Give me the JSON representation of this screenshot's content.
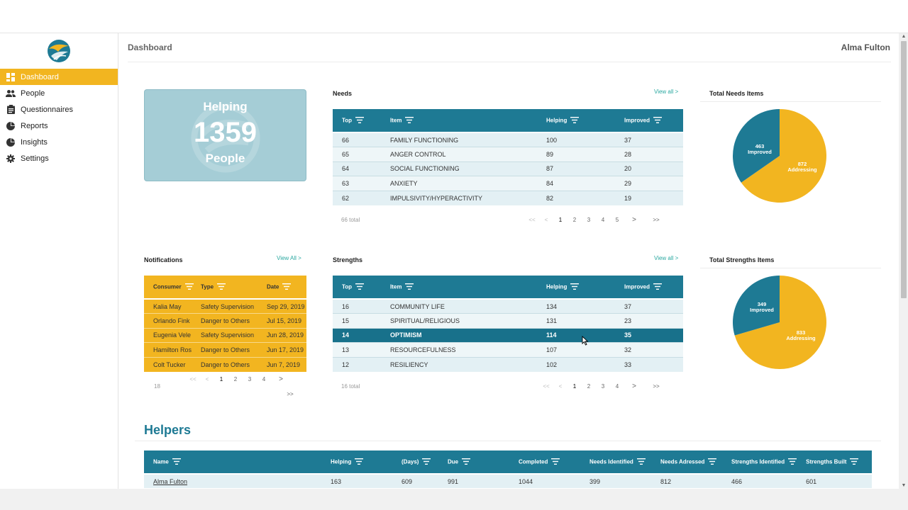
{
  "header": {
    "title": "Dashboard",
    "user": "Alma Fulton"
  },
  "sidebar": {
    "items": [
      {
        "label": "Dashboard",
        "icon": "dashboard-icon",
        "active": true
      },
      {
        "label": "People",
        "icon": "people-icon"
      },
      {
        "label": "Questionnaires",
        "icon": "clipboard-icon"
      },
      {
        "label": "Reports",
        "icon": "pie-chart-icon"
      },
      {
        "label": "Insights",
        "icon": "pie-chart-icon"
      },
      {
        "label": "Settings",
        "icon": "gear-icon"
      }
    ]
  },
  "helping_card": {
    "top": "Helping",
    "number": "1359",
    "bottom": "People"
  },
  "needs": {
    "title": "Needs",
    "view_all": "View all >",
    "columns": [
      "Top",
      "Item",
      "Helping",
      "Improved"
    ],
    "rows": [
      [
        "66",
        "FAMILY FUNCTIONING",
        "100",
        "37"
      ],
      [
        "65",
        "ANGER CONTROL",
        "89",
        "28"
      ],
      [
        "64",
        "SOCIAL FUNCTIONING",
        "87",
        "20"
      ],
      [
        "63",
        "ANXIETY",
        "84",
        "29"
      ],
      [
        "62",
        "IMPULSIVITY/HYPERACTIVITY",
        "82",
        "19"
      ]
    ],
    "total": "66 total",
    "pages": [
      "1",
      "2",
      "3",
      "4",
      "5"
    ]
  },
  "needs_pie": {
    "title": "Total Needs Items",
    "improved_value": "463",
    "improved_label": "Improved",
    "addressing_value": "872",
    "addressing_label": "Addressing"
  },
  "notifications": {
    "title": "Notifications",
    "view_all": "View All >",
    "columns": [
      "Consumer",
      "Type",
      "Date"
    ],
    "rows": [
      [
        "Kalia May",
        "Safety Supervision",
        "Sep 29, 2019"
      ],
      [
        "Orlando Fink",
        "Danger to Others",
        "Jul 15, 2019"
      ],
      [
        "Eugenia Vele",
        "Safety Supervision",
        "Jun 28, 2019"
      ],
      [
        "Hamilton Ros",
        "Danger to Others",
        "Jun 17, 2019"
      ],
      [
        "Colt Tucker",
        "Danger to Others",
        "Jun 7, 2019"
      ]
    ],
    "total": "18",
    "pages": [
      "1",
      "2",
      "3",
      "4"
    ]
  },
  "strengths": {
    "title": "Strengths",
    "view_all": "View all >",
    "columns": [
      "Top",
      "Item",
      "Helping",
      "Improved"
    ],
    "rows": [
      [
        "16",
        "COMMUNITY LIFE",
        "134",
        "37"
      ],
      [
        "15",
        "SPIRITUAL/RELIGIOUS",
        "131",
        "23"
      ],
      [
        "14",
        "OPTIMISM",
        "114",
        "35"
      ],
      [
        "13",
        "RESOURCEFULNESS",
        "107",
        "32"
      ],
      [
        "12",
        "RESILIENCY",
        "102",
        "33"
      ]
    ],
    "selected_row": 2,
    "total": "16 total",
    "pages": [
      "1",
      "2",
      "3",
      "4"
    ]
  },
  "strengths_pie": {
    "title": "Total Strengths Items",
    "improved_value": "349",
    "improved_label": "Improved",
    "addressing_value": "833",
    "addressing_label": "Addressing"
  },
  "helpers": {
    "title": "Helpers",
    "columns": [
      "Name",
      "Helping",
      "(Days)",
      "Due",
      "Completed",
      "Needs Identified",
      "Needs Adressed",
      "Strengths Identified",
      "Strengths Built"
    ],
    "rows": [
      [
        "Alma Fulton",
        "163",
        "609",
        "991",
        "1044",
        "399",
        "812",
        "466",
        "601"
      ]
    ]
  },
  "pager_symbols": {
    "first": "<<",
    "prev": "<",
    "next": ">",
    "last": ">>"
  },
  "colors": {
    "accent": "#f2b520",
    "teal": "#1e7a94",
    "card": "#a5cdd6"
  }
}
